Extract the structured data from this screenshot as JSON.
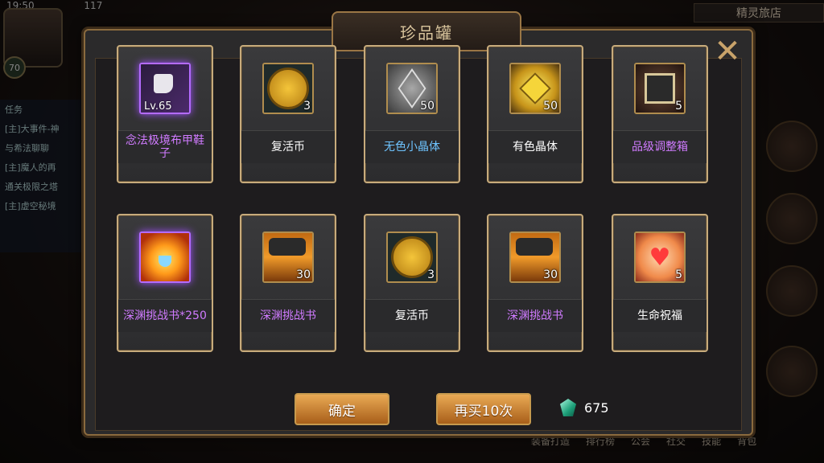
{
  "status_bar": {
    "time": "19:50",
    "count": "117"
  },
  "player": {
    "level": "70"
  },
  "background": {
    "shop_title": "精灵旅店",
    "task_label": "任务",
    "task_lines": [
      "[主]大事件-神",
      "与希法聊聊",
      "[主]魔人的再",
      "通关极限之塔",
      "[主]虚空秘境"
    ],
    "nav_items": [
      "装备打造",
      "排行榜",
      "公会",
      "社交",
      "技能",
      "背包"
    ]
  },
  "dialog": {
    "title": "珍品罐",
    "close_glyph": "✕"
  },
  "items": [
    {
      "name": "念法极境布甲鞋子",
      "level": "Lv.65",
      "count": "",
      "rarity": "purple",
      "icon": "shoe-icon"
    },
    {
      "name": "复活币",
      "level": "",
      "count": "3",
      "rarity": "white",
      "icon": "coin-icon"
    },
    {
      "name": "无色小晶体",
      "level": "",
      "count": "50",
      "rarity": "blue",
      "icon": "grey-cube-icon"
    },
    {
      "name": "有色晶体",
      "level": "",
      "count": "50",
      "rarity": "white",
      "icon": "gold-cube-icon"
    },
    {
      "name": "品级调整箱",
      "level": "",
      "count": "5",
      "rarity": "purple",
      "icon": "box-icon"
    },
    {
      "name": "深渊挑战书*250",
      "level": "",
      "count": "",
      "rarity": "purple",
      "icon": "sun-icon"
    },
    {
      "name": "深渊挑战书",
      "level": "",
      "count": "30",
      "rarity": "purple",
      "icon": "book-icon"
    },
    {
      "name": "复活币",
      "level": "",
      "count": "3",
      "rarity": "white",
      "icon": "coin-icon"
    },
    {
      "name": "深渊挑战书",
      "level": "",
      "count": "30",
      "rarity": "purple",
      "icon": "book-icon"
    },
    {
      "name": "生命祝福",
      "level": "",
      "count": "5",
      "rarity": "white",
      "icon": "heart-icon"
    }
  ],
  "buttons": {
    "confirm": "确定",
    "buy_again": "再买10次"
  },
  "currency": {
    "amount": "675"
  }
}
